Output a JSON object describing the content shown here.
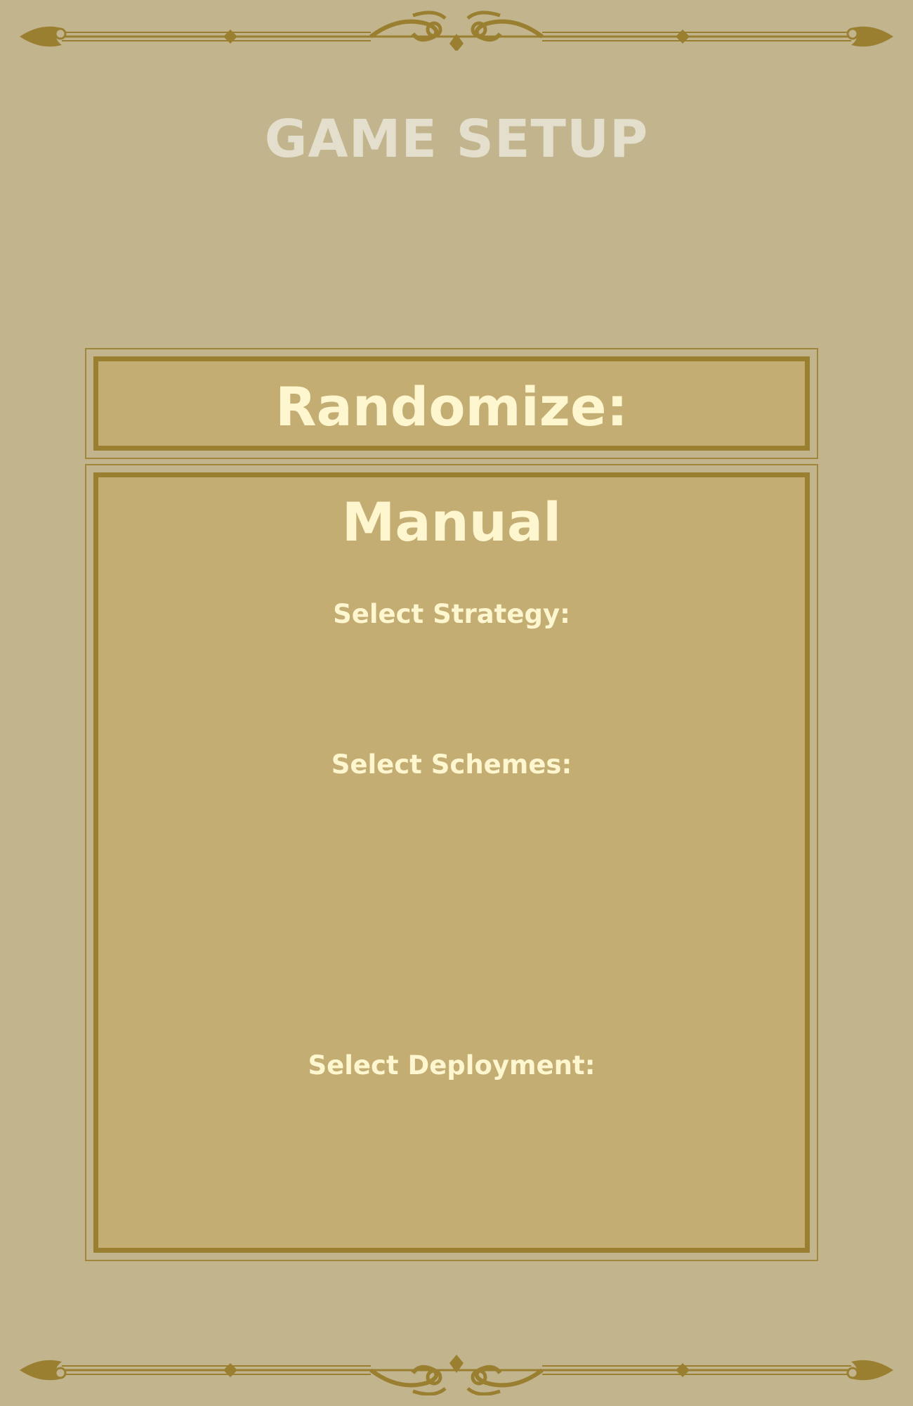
{
  "page": {
    "title": "GAME SETUP"
  },
  "randomize": {
    "heading": "Randomize:"
  },
  "manual": {
    "heading": "Manual",
    "strategy_label": "Select Strategy:",
    "schemes_label": "Select Schemes:",
    "deployment_label": "Select Deployment:"
  },
  "theme": {
    "background": "#c2b58e",
    "panel_fill": "#c3ad73",
    "border": "#9a7f30",
    "title_color": "#e4dfcd",
    "label_color": "#fdf6cf",
    "ornament_color": "#9a7f30",
    "top_ornament_icon": "flourish-divider-icon",
    "bottom_ornament_icon": "flourish-divider-icon"
  }
}
